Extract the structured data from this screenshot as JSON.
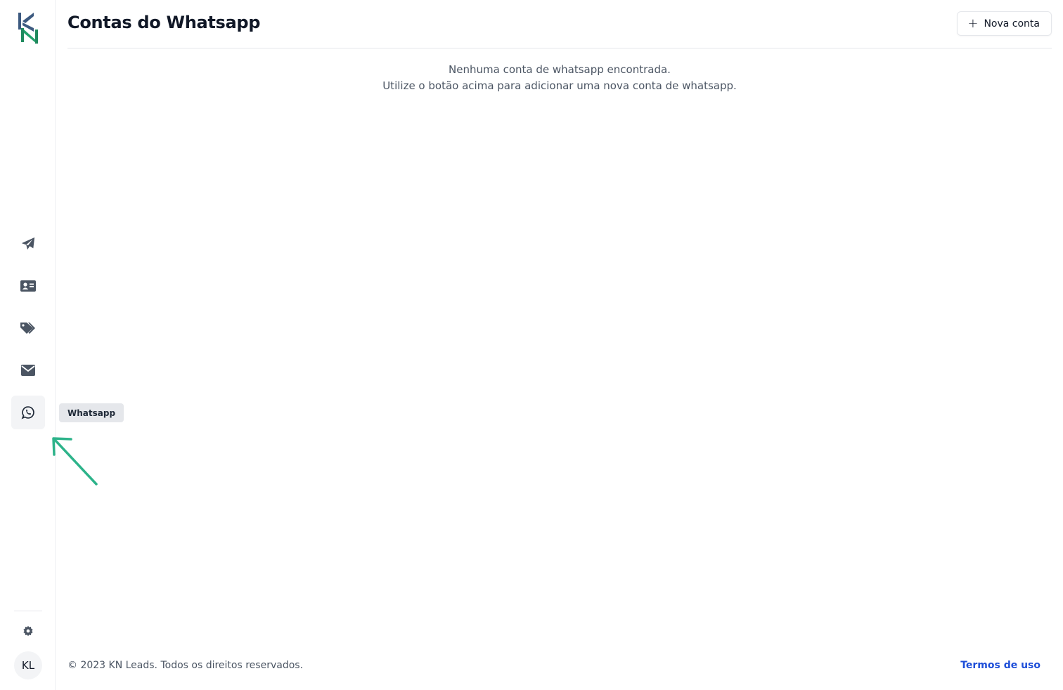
{
  "header": {
    "title": "Contas do Whatsapp",
    "new_account_label": "Nova conta"
  },
  "empty_state": {
    "line1": "Nenhuma conta de whatsapp encontrada.",
    "line2": "Utilize o botão acima para adicionar uma nova conta de whatsapp."
  },
  "sidebar": {
    "items": [
      {
        "icon": "paper-plane-icon"
      },
      {
        "icon": "id-card-icon"
      },
      {
        "icon": "tags-icon"
      },
      {
        "icon": "envelope-icon"
      },
      {
        "icon": "whatsapp-icon",
        "active": true,
        "tooltip": "Whatsapp"
      }
    ],
    "settings_icon": "gear-icon",
    "avatar_initials": "KL"
  },
  "footer": {
    "copyright": "© 2023 KN Leads. Todos os direitos reservados.",
    "terms_label": "Termos de uso"
  },
  "colors": {
    "icon": "#4b5563",
    "brand_dark": "#1e3a5f",
    "brand_green": "#22a06b",
    "annotation_arrow": "#2db38a",
    "link": "#1d4ed8"
  }
}
